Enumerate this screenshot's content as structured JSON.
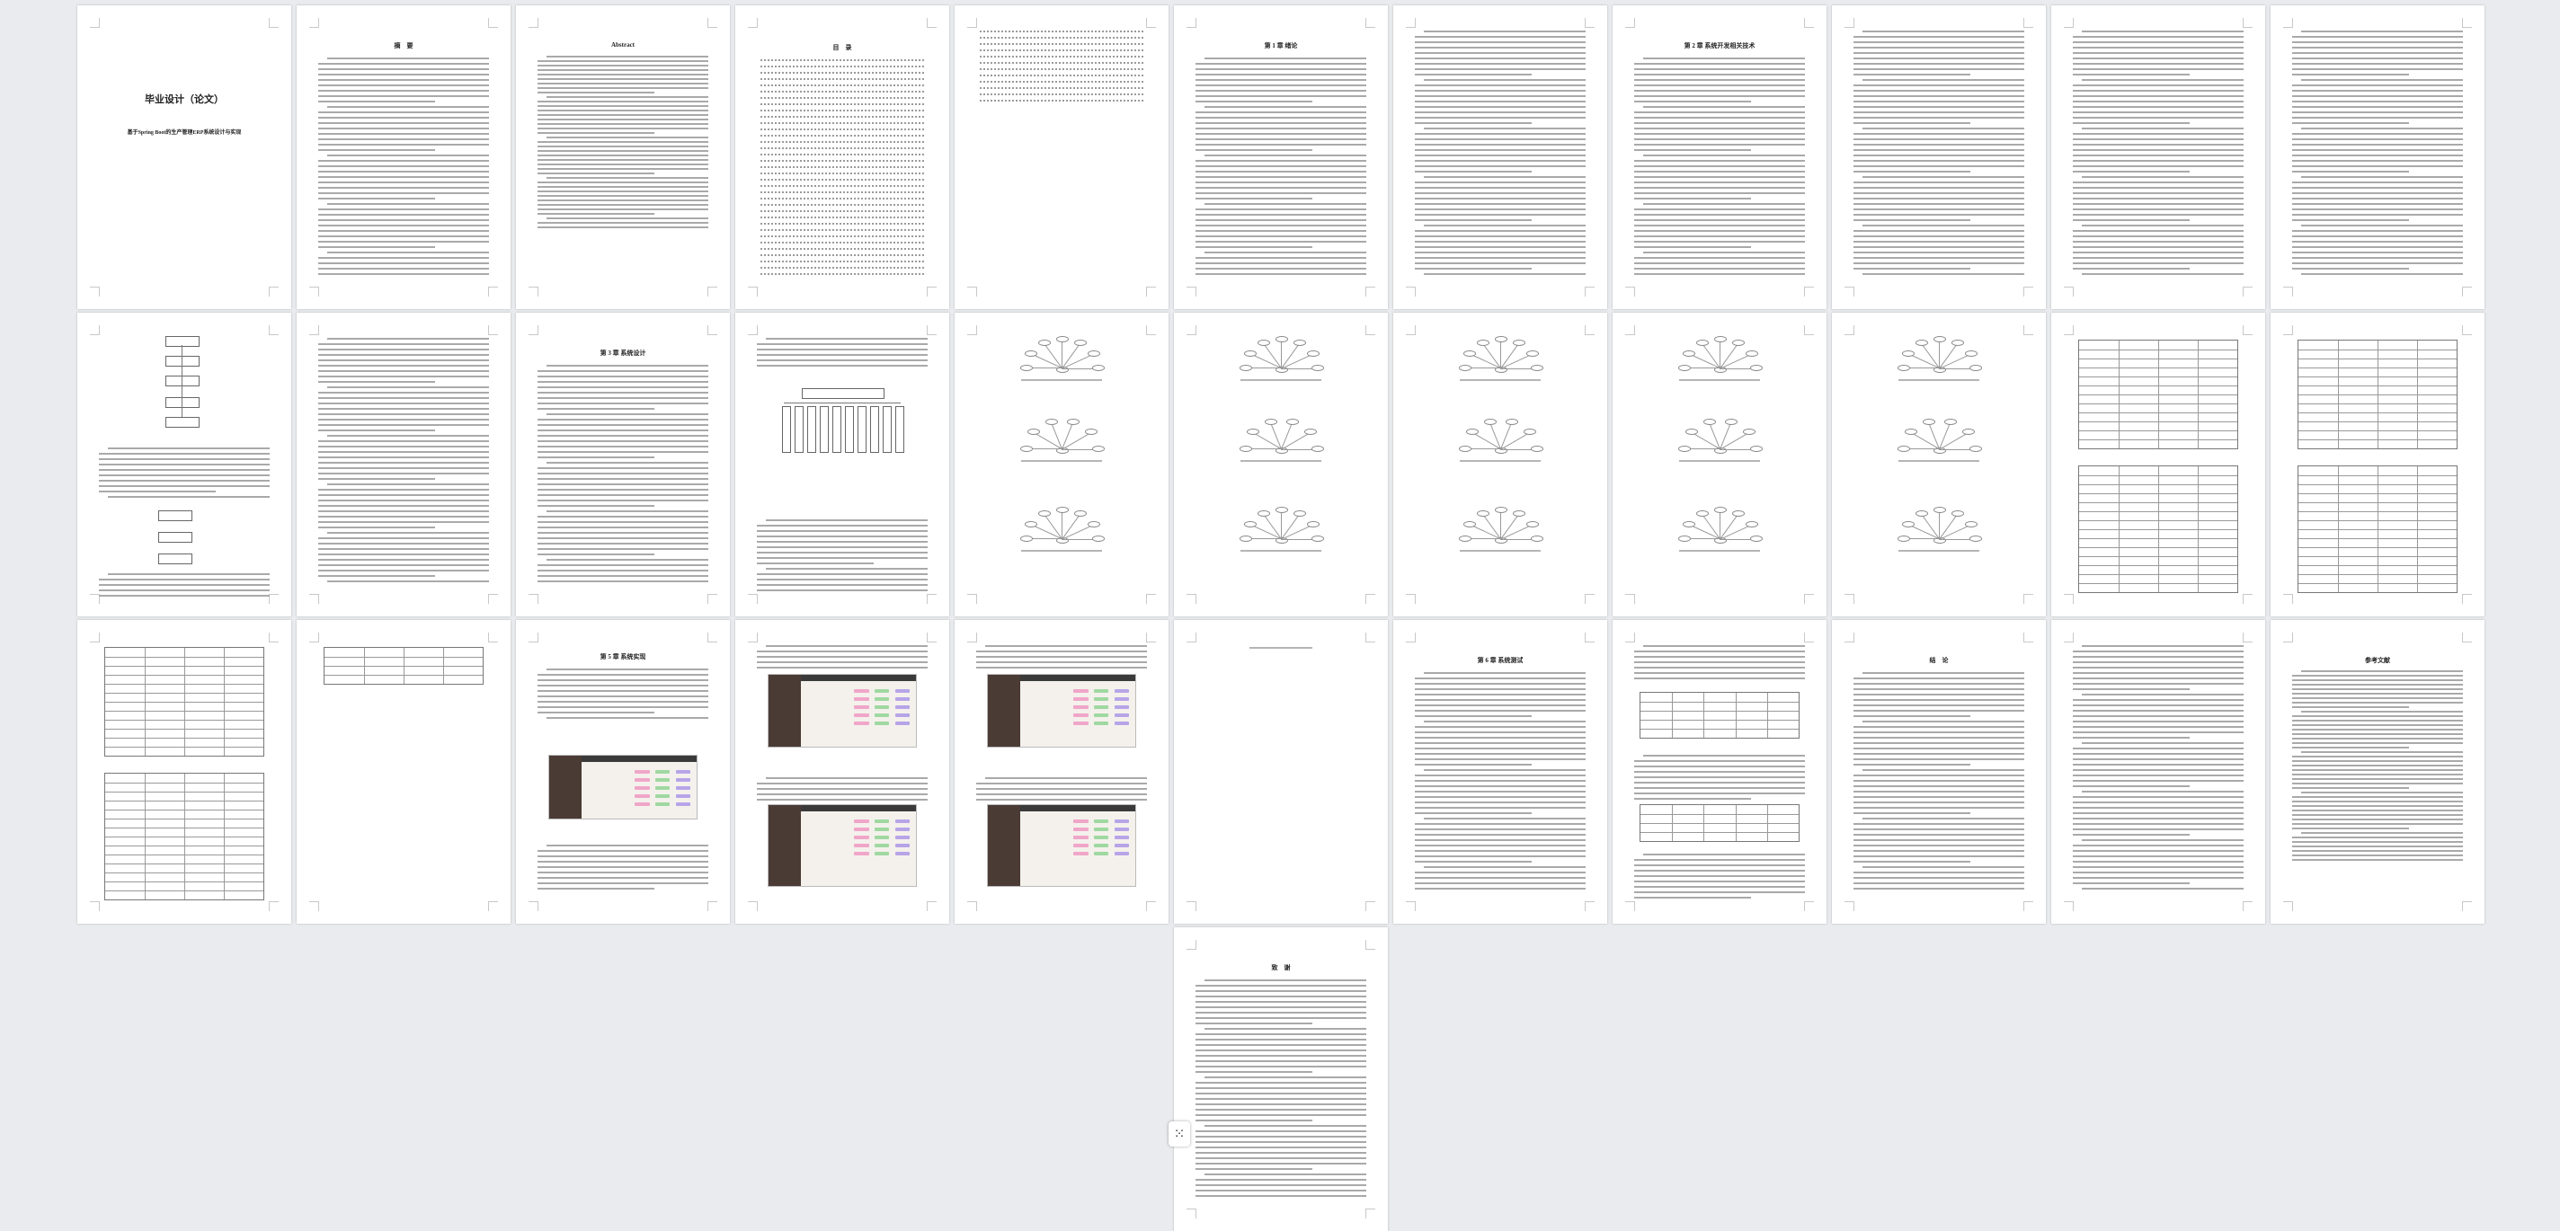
{
  "viewer": {
    "floating_button_glyph": "⁙",
    "colors": {
      "background": "#e9ebee",
      "page": "#ffffff",
      "text_line": "#a9a9a9"
    }
  },
  "pages": [
    {
      "kind": "cover",
      "title": "毕业设计（论文）",
      "subtitle": "基于Spring Boot的生产管理ERP系统设计与实现"
    },
    {
      "kind": "text",
      "title": "摘　要"
    },
    {
      "kind": "text-en",
      "title": "Abstract"
    },
    {
      "kind": "toc",
      "title": "目　录"
    },
    {
      "kind": "toc2",
      "title": ""
    },
    {
      "kind": "text",
      "title": "第 1 章  绪论"
    },
    {
      "kind": "text",
      "title": ""
    },
    {
      "kind": "text",
      "title": "第 2 章  系统开发相关技术"
    },
    {
      "kind": "text",
      "title": ""
    },
    {
      "kind": "text",
      "title": ""
    },
    {
      "kind": "text",
      "title": ""
    },
    {
      "kind": "flow",
      "title": ""
    },
    {
      "kind": "text",
      "title": ""
    },
    {
      "kind": "text",
      "title": "第 3 章  系统设计"
    },
    {
      "kind": "tree",
      "title": ""
    },
    {
      "kind": "er",
      "title": ""
    },
    {
      "kind": "er",
      "title": ""
    },
    {
      "kind": "er",
      "title": ""
    },
    {
      "kind": "er",
      "title": ""
    },
    {
      "kind": "er",
      "title": ""
    },
    {
      "kind": "table",
      "title": ""
    },
    {
      "kind": "table",
      "title": ""
    },
    {
      "kind": "table",
      "title": ""
    },
    {
      "kind": "table-small",
      "title": ""
    },
    {
      "kind": "shot",
      "title": "第 5 章  系统实现"
    },
    {
      "kind": "shot",
      "title": ""
    },
    {
      "kind": "shot",
      "title": ""
    },
    {
      "kind": "blank",
      "title": ""
    },
    {
      "kind": "text",
      "title": "第 6 章  系统测试"
    },
    {
      "kind": "text-table",
      "title": ""
    },
    {
      "kind": "text",
      "title": "结　论"
    },
    {
      "kind": "text",
      "title": ""
    },
    {
      "kind": "ref",
      "title": "参考文献"
    },
    {
      "kind": "text",
      "title": "致　谢"
    }
  ]
}
